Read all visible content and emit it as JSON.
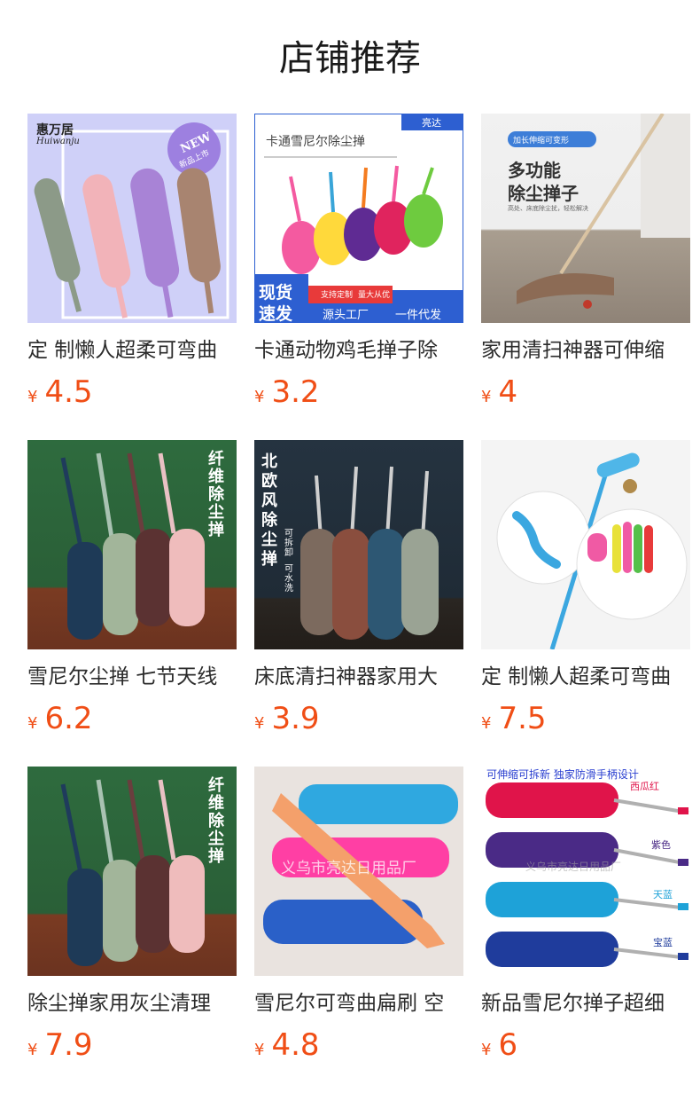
{
  "page": {
    "title": "店铺推荐"
  },
  "currency": "¥",
  "products": [
    {
      "name": "定 制懒人超柔可弯曲",
      "price": "4.5",
      "image_text": [
        "惠万居",
        "Huiwanju",
        "NEW",
        "新品上市"
      ]
    },
    {
      "name": "卡通动物鸡毛掸子除",
      "price": "3.2",
      "image_text": [
        "卡通雪尼尔除尘掸",
        "亮达",
        "现货",
        "速发",
        "支持定制",
        "量大从优",
        "源头工厂",
        "一件代发"
      ]
    },
    {
      "name": "家用清扫神器可伸缩",
      "price": "4",
      "image_text": [
        "加长伸缩可变形",
        "多功能",
        "除尘掸子",
        "高处、床底除尘扰，轻松解决"
      ]
    },
    {
      "name": "雪尼尔尘掸 七节天线",
      "price": "6.2",
      "image_text": [
        "纤维除尘掸"
      ]
    },
    {
      "name": "床底清扫神器家用大",
      "price": "3.9",
      "image_text": [
        "北欧风除尘掸",
        "可拆卸",
        "可水洗"
      ]
    },
    {
      "name": "定 制懒人超柔可弯曲",
      "price": "7.5",
      "image_text": []
    },
    {
      "name": "除尘掸家用灰尘清理",
      "price": "7.9",
      "image_text": [
        "纤维除尘掸"
      ]
    },
    {
      "name": "雪尼尔可弯曲扁刷 空",
      "price": "4.8",
      "image_text": [
        "义乌市亮达日用品厂"
      ]
    },
    {
      "name": "新品雪尼尔掸子超细",
      "price": "6",
      "image_text": [
        "可伸缩可拆新 独家防滑手柄设计",
        "西瓜红",
        "紫色",
        "天蓝",
        "宝蓝",
        "义乌市亮达日用品厂"
      ]
    }
  ]
}
